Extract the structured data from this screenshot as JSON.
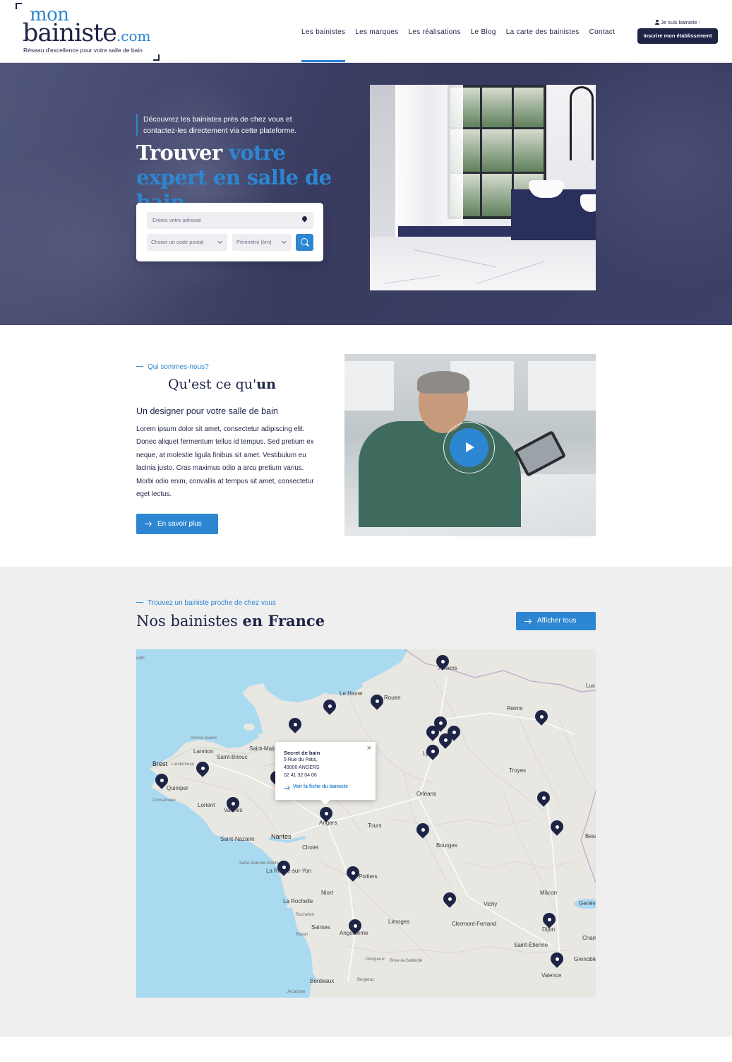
{
  "header": {
    "logo": {
      "line1": "mon",
      "line2": "bainiste",
      "suffix": ".com",
      "tagline": "Réseau d'excellence pour votre salle de bain"
    },
    "nav": [
      {
        "label": "Les bainistes",
        "active": true
      },
      {
        "label": "Les marques",
        "active": false
      },
      {
        "label": "Les réalisations",
        "active": false
      },
      {
        "label": "Le Blog",
        "active": false
      },
      {
        "label": "La carte des bainistes",
        "active": false
      },
      {
        "label": "Contact",
        "active": false
      }
    ],
    "pro_label": "Je suis bainiste :",
    "pro_button": "Inscrire mon établissement"
  },
  "hero": {
    "intro": "Découvrez les bainistes près de chez vous et contactez-les directement via cette plateforme.",
    "title_white": "Trouver",
    "title_blue": "votre expert en salle de bain",
    "search": {
      "address_placeholder": "Entrez votre adresse",
      "postal_placeholder": "Choisir un code postal",
      "radius_placeholder": "Périmètre (km)"
    }
  },
  "about": {
    "kicker": "Qui sommes-nous?",
    "title_regular": "Qu'est ce qu'",
    "title_bold": "un",
    "subtitle": "Un designer pour votre salle de bain",
    "body": "Lorem ipsum dolor sit amet, consectetur adipiscing elit. Donec aliquet fermentum tellus id tempus. Sed pretium ex neque, at molestie ligula finibus sit amet. Vestibulum eu lacinia justo. Cras maximus odio a arcu pretium varius. Morbi odio enim, convallis at tempus sit amet, consectetur eget lectus.",
    "button": "En savoir plus"
  },
  "map_section": {
    "kicker": "Trouvez un bainiste proche de chez vous",
    "title_regular": "Nos bainistes",
    "title_bold": "en France",
    "button": "Afficher tous",
    "places": [
      "outh",
      "Le Havre",
      "Rouen",
      "Reims",
      "Lux",
      "Perros-Guirec",
      "Lannion",
      "Saint-Malo",
      "Saint-Brieuc",
      "Brest",
      "Landerneau",
      "Quimper",
      "Concarneau",
      "Lorient",
      "Vannes",
      "Saint-Nazaire",
      "Nantes",
      "Cholet",
      "Saint-Jean-de-Monts",
      "La Roche-sur-Yon",
      "Troyes",
      "Orléans",
      "Tours",
      "Bourges",
      "Besançon",
      "Niort",
      "La Rochelle",
      "Rochefort",
      "Royan",
      "Saintes",
      "Angoulême",
      "Limoges",
      "Vichy",
      "Clermont-Ferrand",
      "Mâcon",
      "Genève",
      "Saint-Étienne",
      "Chambéry",
      "Grenoble",
      "Valence",
      "Périgueux",
      "Brive-la-Gaillarde",
      "Bordeaux",
      "Bergerac",
      "Arcachon",
      "Amiens",
      "Angers",
      "Poitiers",
      "Dijon",
      "Lyon"
    ],
    "popup": {
      "name": "Secret de bain",
      "address1": "5 Rue du Patis,",
      "address2": "49000 ANGERS",
      "phone": "02 41 32 04 06",
      "link": "Voir la fiche du bainiste",
      "close": "×"
    }
  },
  "colors": {
    "navy": "#1e2446",
    "accent": "#2d86d1",
    "hero_bg": "#3a3d63",
    "map_section_bg": "#efeff0"
  }
}
